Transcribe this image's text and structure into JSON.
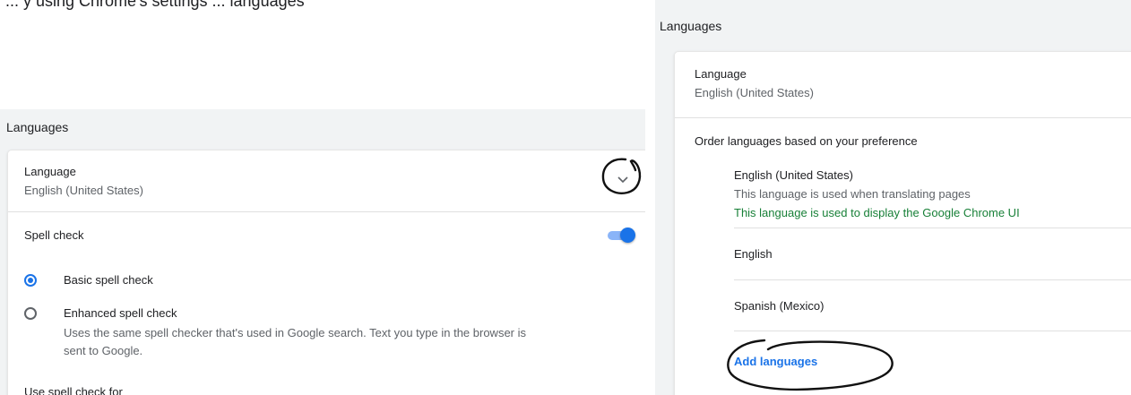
{
  "top_caption": "... y using Chrome's settings ... languages",
  "left": {
    "section_title": "Languages",
    "language_label": "Language",
    "language_value": "English (United States)",
    "spell_check_label": "Spell check",
    "spell_check_enabled": true,
    "basic_label": "Basic spell check",
    "enhanced_label": "Enhanced spell check",
    "enhanced_desc": "Uses the same spell checker that's used in Google search. Text you type in the browser is sent to Google.",
    "use_spell_for": "Use spell check for"
  },
  "right": {
    "section_title": "Languages",
    "language_label": "Language",
    "language_value": "English (United States)",
    "order_label": "Order languages based on your preference",
    "languages": [
      {
        "name": "English (United States)",
        "note": "This language is used when translating pages",
        "ui_note": "This language is used to display the Google Chrome UI"
      },
      {
        "name": "English"
      },
      {
        "name": "Spanish (Mexico)"
      }
    ],
    "add_languages": "Add languages"
  },
  "colors": {
    "accent": "#1a73e8",
    "ui_note": "#188038",
    "panel_bg": "#f1f3f4"
  }
}
